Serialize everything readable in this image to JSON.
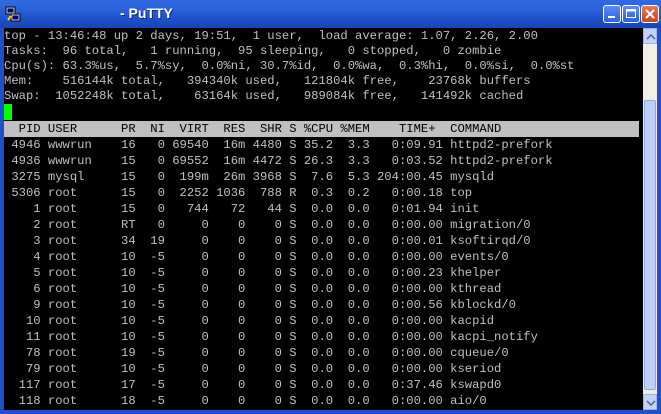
{
  "window": {
    "title": "- PuTTY",
    "icon": "putty-app-icon",
    "controls": [
      "minimize",
      "maximize",
      "close"
    ]
  },
  "terminal": {
    "summary": [
      "top - 13:46:48 up 2 days, 19:51,  1 user,  load average: 1.07, 2.26, 2.00",
      "Tasks:  96 total,   1 running,  95 sleeping,   0 stopped,   0 zombie",
      "Cpu(s): 63.3%us,  5.7%sy,  0.0%ni, 30.7%id,  0.0%wa,  0.3%hi,  0.0%si,  0.0%st",
      "Mem:    516144k total,   394340k used,   121804k free,    23768k buffers",
      "Swap:  1052248k total,    63164k used,   989084k free,   141492k cached"
    ],
    "header": "  PID USER      PR  NI  VIRT  RES  SHR S %CPU %MEM    TIME+  COMMAND",
    "rows": [
      " 4946 wwwrun    16   0 69540  16m 4480 S 35.2  3.3   0:09.91 httpd2-prefork",
      " 4936 wwwrun    15   0 69552  16m 4472 S 26.3  3.3   0:03.52 httpd2-prefork",
      " 3275 mysql     15   0  199m  26m 3968 S  7.6  5.3 204:00.45 mysqld",
      " 5306 root      15   0  2252 1036  788 R  0.3  0.2   0:00.18 top",
      "    1 root      15   0   744   72   44 S  0.0  0.0   0:01.94 init",
      "    2 root      RT   0     0    0    0 S  0.0  0.0   0:00.00 migration/0",
      "    3 root      34  19     0    0    0 S  0.0  0.0   0:00.01 ksoftirqd/0",
      "    4 root      10  -5     0    0    0 S  0.0  0.0   0:00.00 events/0",
      "    5 root      10  -5     0    0    0 S  0.0  0.0   0:00.23 khelper",
      "    6 root      10  -5     0    0    0 S  0.0  0.0   0:00.00 kthread",
      "    9 root      10  -5     0    0    0 S  0.0  0.0   0:00.56 kblockd/0",
      "   10 root      10  -5     0    0    0 S  0.0  0.0   0:00.00 kacpid",
      "   11 root      10  -5     0    0    0 S  0.0  0.0   0:00.00 kacpi_notify",
      "   78 root      19  -5     0    0    0 S  0.0  0.0   0:00.00 cqueue/0",
      "   79 root      10  -5     0    0    0 S  0.0  0.0   0:00.00 kseriod",
      "  117 root      17  -5     0    0    0 S  0.0  0.0   0:37.46 kswapd0",
      "  118 root      18  -5     0    0    0 S  0.0  0.0   0:00.00 aio/0"
    ]
  },
  "colors": {
    "titlebar": "#2a5fd6",
    "terminal_bg": "#000000",
    "terminal_fg": "#c0c0c0",
    "header_bar": "#c0c0c0",
    "cursor": "#00ff00"
  }
}
